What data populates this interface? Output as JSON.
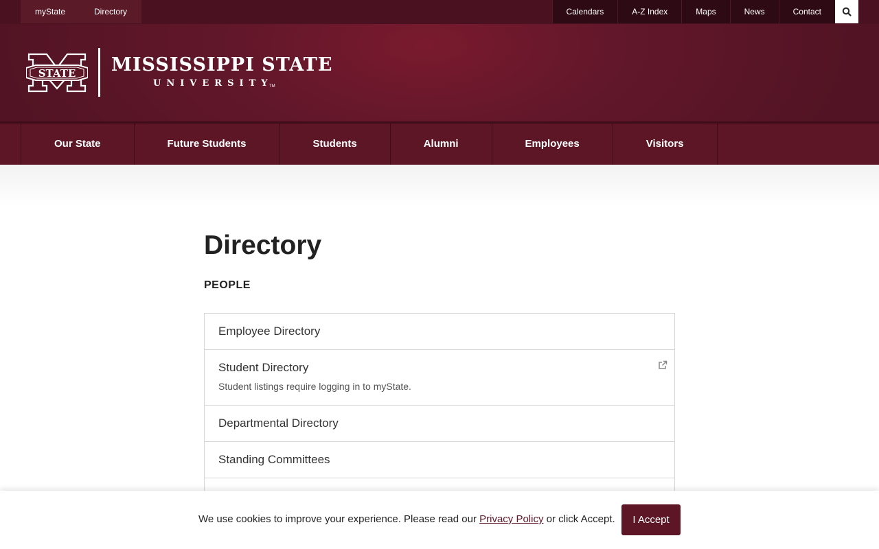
{
  "utility": {
    "left_links": [
      "myState",
      "Directory"
    ],
    "right_links": [
      "Calendars",
      "A-Z Index",
      "Maps",
      "News",
      "Contact"
    ]
  },
  "brand": {
    "line1": "MISSISSIPPI STATE",
    "line2": "UNIVERSITY",
    "tm": "TM",
    "seal_text": "STATE"
  },
  "nav": {
    "items": [
      "Our State",
      "Future Students",
      "Students",
      "Alumni",
      "Employees",
      "Visitors"
    ]
  },
  "page": {
    "title": "Directory",
    "section": "PEOPLE"
  },
  "directory": {
    "items": [
      {
        "title": "Employee Directory"
      },
      {
        "title": "Student Directory",
        "desc": "Student listings require logging in to myState.",
        "icon": "external-link-icon"
      },
      {
        "title": "Departmental Directory"
      },
      {
        "title": "Standing Committees"
      }
    ]
  },
  "cookie": {
    "text_before": "We use cookies to improve your experience. Please read our ",
    "link": "Privacy Policy",
    "text_after": " or click Accept.",
    "button": "I Accept"
  },
  "colors": {
    "maroon": "#5d1625",
    "dark_maroon": "#4a1220"
  }
}
